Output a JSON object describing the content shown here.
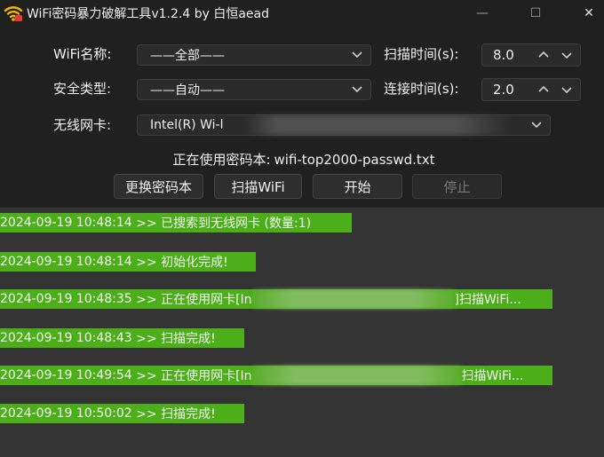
{
  "window": {
    "title": "WiFi密码暴力破解工具v1.2.4 by 白恒aead",
    "minimize_label": "—",
    "maximize_label": "☐",
    "close_label": "✕"
  },
  "form": {
    "wifi_name_label": "WiFi名称:",
    "wifi_name_value": "——全部——",
    "security_label": "安全类型:",
    "security_value": "——自动——",
    "adapter_label": "无线网卡:",
    "adapter_value": "Intel(R) Wi-l",
    "scan_time_label": "扫描时间(s):",
    "scan_time_value": "8.0",
    "connect_time_label": "连接时间(s):",
    "connect_time_value": "2.0",
    "dict_label": "正在使用密码本:",
    "dict_file": "wifi-top2000-passwd.txt"
  },
  "buttons": {
    "change_dict": "更换密码本",
    "scan_wifi": "扫描WiFi",
    "start": "开始",
    "stop": "停止"
  },
  "log": [
    {
      "ts": "2024-09-19 10:48:14",
      "msg": ">> 已搜索到无线网卡 (数量:1)"
    },
    {
      "ts": "2024-09-19 10:48:14",
      "msg": ">> 初始化完成!"
    },
    {
      "ts": "2024-09-19 10:48:35",
      "msg": ">> 正在使用网卡[In",
      "tail": "]扫描WiFi..."
    },
    {
      "ts": "2024-09-19 10:48:43",
      "msg": ">> 扫描完成!"
    },
    {
      "ts": "2024-09-19 10:49:54",
      "msg": ">> 正在使用网卡[In",
      "tail": "扫描WiFi..."
    },
    {
      "ts": "2024-09-19 10:50:02",
      "msg": ">> 扫描完成!"
    }
  ],
  "colors": {
    "log_highlight": "#4caf19",
    "window_bg": "#202020",
    "log_bg": "#333333"
  },
  "icons": {
    "app": "wifi-icon",
    "dropdown": "chevron-down-icon",
    "spin_up": "chevron-up-icon",
    "spin_down": "chevron-down-icon"
  }
}
